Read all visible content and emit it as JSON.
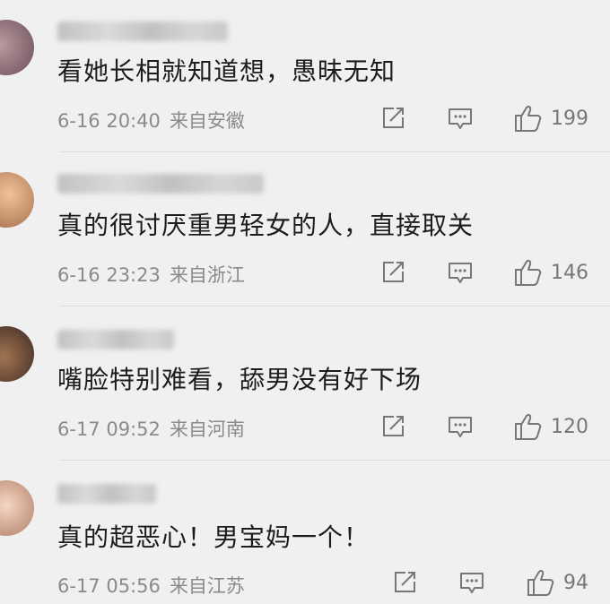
{
  "comments": [
    {
      "username": "",
      "text": "看她长相就知道想，愚昧无知",
      "time": "6-16 20:40",
      "location": "来自安徽",
      "likes": "199",
      "avatar_color": "#8a6a72"
    },
    {
      "username": "",
      "text": "真的很讨厌重男轻女的人，直接取关",
      "time": "6-16 23:23",
      "location": "来自浙江",
      "likes": "146",
      "avatar_color": "#c9956d"
    },
    {
      "username": "",
      "text": "嘴脸特别难看，舔男没有好下场",
      "time": "6-17 09:52",
      "location": "来自河南",
      "likes": "120",
      "avatar_color": "#6d4a3a"
    },
    {
      "username": "",
      "text": "真的超恶心！男宝妈一个！",
      "time": "6-17 05:56",
      "location": "来自江苏",
      "likes": "94",
      "avatar_color": "#e2b9a4"
    }
  ],
  "icons": {
    "share": "share-icon",
    "comment": "comment-icon",
    "like": "thumbs-up-icon"
  }
}
